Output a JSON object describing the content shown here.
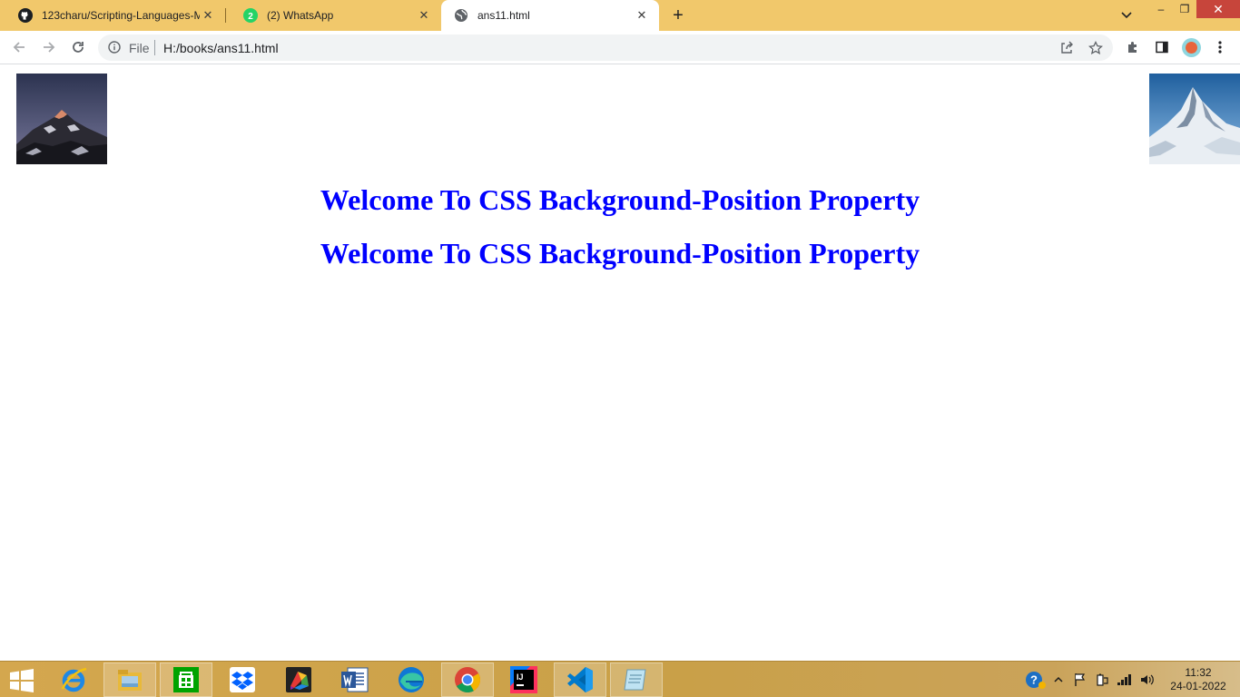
{
  "browser": {
    "tabs": [
      {
        "title": "123charu/Scripting-Languages-M",
        "favicon": "github-icon",
        "active": false
      },
      {
        "title": "(2) WhatsApp",
        "favicon": "whatsapp-icon",
        "badge": "2",
        "active": false
      },
      {
        "title": "ans11.html",
        "favicon": "globe-icon",
        "active": true
      }
    ],
    "close_glyph": "✕",
    "new_tab_glyph": "+",
    "window_controls": {
      "minimize": "–",
      "maximize": "❐",
      "close": "✕"
    },
    "omnibox": {
      "scheme_label": "File",
      "url": "H:/books/ans11.html"
    }
  },
  "page": {
    "images": [
      {
        "name": "mountain-dusk-image",
        "position": "top-left"
      },
      {
        "name": "snowy-peak-image",
        "position": "top-right"
      }
    ],
    "headings": [
      "Welcome To CSS Background-Position Property",
      "Welcome To CSS Background-Position Property"
    ],
    "heading_color": "#0000ff"
  },
  "taskbar": {
    "apps": [
      {
        "name": "internet-explorer-icon"
      },
      {
        "name": "file-explorer-icon"
      },
      {
        "name": "store-icon"
      },
      {
        "name": "dropbox-icon"
      },
      {
        "name": "paint-app-icon"
      },
      {
        "name": "word-icon"
      },
      {
        "name": "edge-icon"
      },
      {
        "name": "chrome-icon",
        "active": true
      },
      {
        "name": "intellij-icon"
      },
      {
        "name": "vscode-icon"
      },
      {
        "name": "notepad-app-icon"
      }
    ],
    "clock": {
      "time": "11:32",
      "date": "24-01-2022"
    }
  }
}
